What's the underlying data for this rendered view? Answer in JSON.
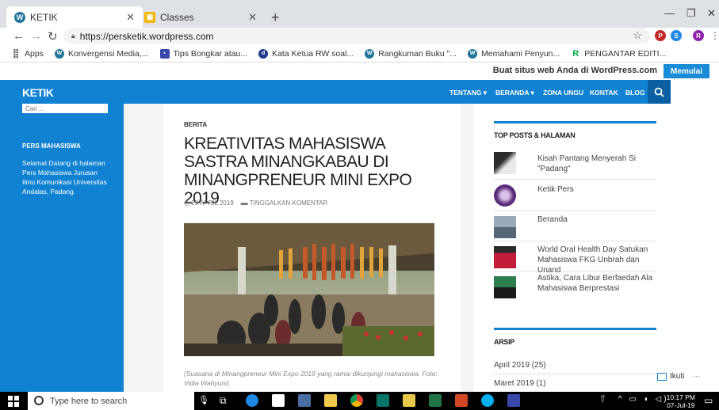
{
  "tabs": [
    {
      "label": "KETIK",
      "active": true
    },
    {
      "label": "Classes",
      "active": false
    }
  ],
  "address": {
    "url": "https://persketik.wordpress.com"
  },
  "bookmarks": [
    {
      "label": "Apps"
    },
    {
      "label": "Konvergensi Media,..."
    },
    {
      "label": "Tips Bongkar atau..."
    },
    {
      "label": "Kata Ketua RW soal..."
    },
    {
      "label": "Rangkuman Buku \"..."
    },
    {
      "label": "Memahami Penyun..."
    },
    {
      "label": "PENGANTAR EDITI..."
    }
  ],
  "wp": {
    "promo": "Buat situs web Anda di WordPress.com",
    "button": "Memulai"
  },
  "site": {
    "title": "KETIK",
    "menu": [
      "TENTANG ▾",
      "BERANDA ▾",
      "ZONA UNGU",
      "KONTAK",
      "BLOG"
    ]
  },
  "left": {
    "search_placeholder": "Cari ...",
    "widget_title": "PERS MAHASISWA",
    "widget_text": "Selamat Datang di halaman Pers Mahasiswa Jurusan Ilmu Komunikasi Universitas Andalas, Padang."
  },
  "article": {
    "category": "BERITA",
    "title": "KREATIVITAS MAHASISWA SASTRA MINANGKABAU DI MINANGPRENEUR MINI EXPO 2019",
    "date": "29 APRIL 2019",
    "comment": "TINGGALKAN KOMENTAR",
    "caption": "(Suasana di Minangpreneur Mini Expo 2019 yang ramai dikunjungi mahasiswa. Foto: Vidia Wahyuni)."
  },
  "right": {
    "top_title": "TOP POSTS & HALAMAN",
    "posts": [
      {
        "title": "Kisah Pantang Menyerah Si \"Padang\""
      },
      {
        "title": "Ketik Pers"
      },
      {
        "title": "Beranda"
      },
      {
        "title": "World Oral Health Day Satukan Mahasiswa FKG Unbrah dan Unand"
      },
      {
        "title": "Astika, Cara Libur Berfaedah Ala Mahasiswa Berprestasi"
      }
    ],
    "archive_title": "ARSIP",
    "archives": [
      {
        "label": "April 2019 (25)"
      },
      {
        "label": "Maret 2019 (1)"
      }
    ]
  },
  "follow": {
    "label": "Ikuti",
    "more": "···"
  },
  "taskbar": {
    "search": "Type here to search",
    "time": "10:17 PM",
    "date": "07-Jul-19"
  },
  "colors": {
    "accent": "#1182d1",
    "dark_accent": "#0a5fa3",
    "wp_button": "#1a8bd8"
  }
}
